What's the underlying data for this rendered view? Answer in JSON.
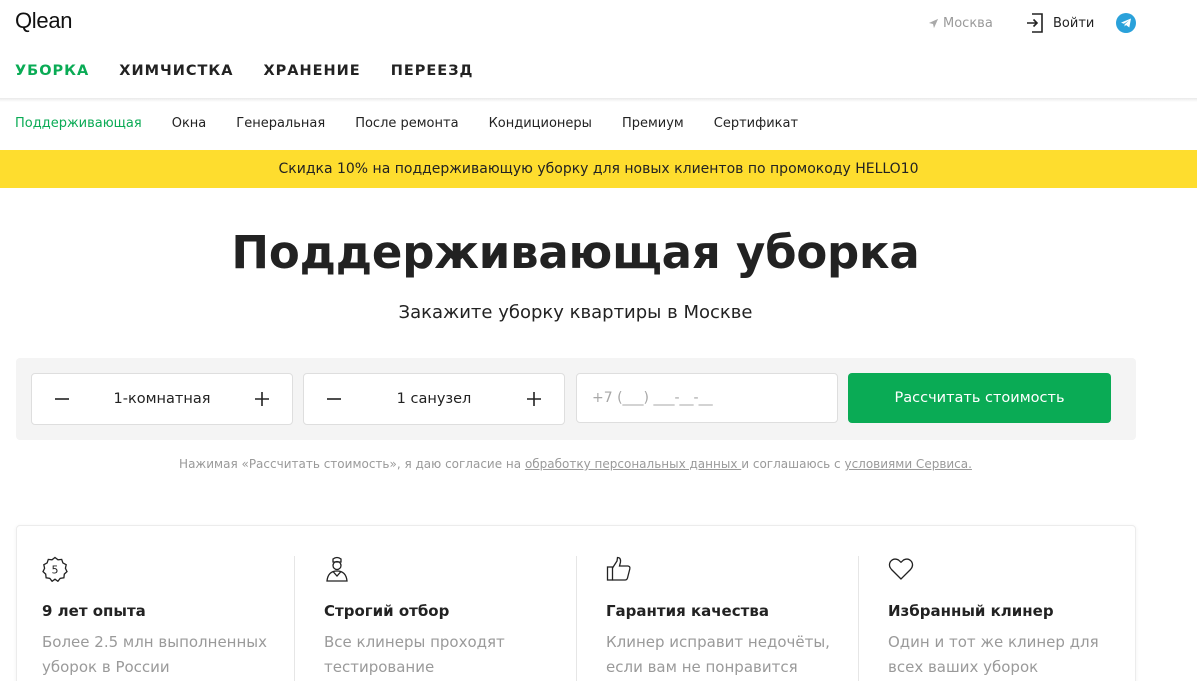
{
  "header": {
    "logo": "Qlean",
    "city": "Москва",
    "login_label": "Войти"
  },
  "main_nav": [
    {
      "label": "УБОРКА",
      "active": true
    },
    {
      "label": "ХИМЧИСТКА",
      "active": false
    },
    {
      "label": "ХРАНЕНИЕ",
      "active": false
    },
    {
      "label": "ПЕРЕЕЗД",
      "active": false
    }
  ],
  "sub_nav": [
    {
      "label": "Поддерживающая",
      "active": true
    },
    {
      "label": "Окна",
      "active": false
    },
    {
      "label": "Генеральная",
      "active": false
    },
    {
      "label": "После ремонта",
      "active": false
    },
    {
      "label": "Кондиционеры",
      "active": false
    },
    {
      "label": "Премиум",
      "active": false
    },
    {
      "label": "Сертификат",
      "active": false
    }
  ],
  "promo": "Скидка 10% на поддерживающую уборку для новых клиентов по промокоду HELLO10",
  "hero": {
    "title": "Поддерживающая уборка",
    "subtitle": "Закажите уборку квартиры в Москве"
  },
  "calculator": {
    "rooms_value": "1-комнатная",
    "bathrooms_value": "1 санузел",
    "phone_placeholder": "+7 (___) ___-__-__",
    "submit_label": "Рассчитать стоимость"
  },
  "consent": {
    "prefix": "Нажимая «Рассчитать стоимость», я даю согласие на ",
    "link1": "обработку персональных данных ",
    "middle": "и соглашаюсь с ",
    "link2": "условиями Сервиса."
  },
  "features": [
    {
      "icon": "badge-5-icon",
      "title": "9 лет опыта",
      "desc": "Более 2.5 млн выполненных уборок в России"
    },
    {
      "icon": "cleaner-person-icon",
      "title": "Строгий отбор",
      "desc": "Все клинеры проходят тестирование"
    },
    {
      "icon": "thumbs-up-icon",
      "title": "Гарантия качества",
      "desc": "Клинер исправит недочёты, если вам не понравится"
    },
    {
      "icon": "heart-icon",
      "title": "Избранный клинер",
      "desc": "Один и тот же клинер для всех ваших уборок"
    }
  ],
  "colors": {
    "accent_green": "#0aab55",
    "promo_yellow": "#fedd2e",
    "telegram_blue": "#2aa1da"
  }
}
